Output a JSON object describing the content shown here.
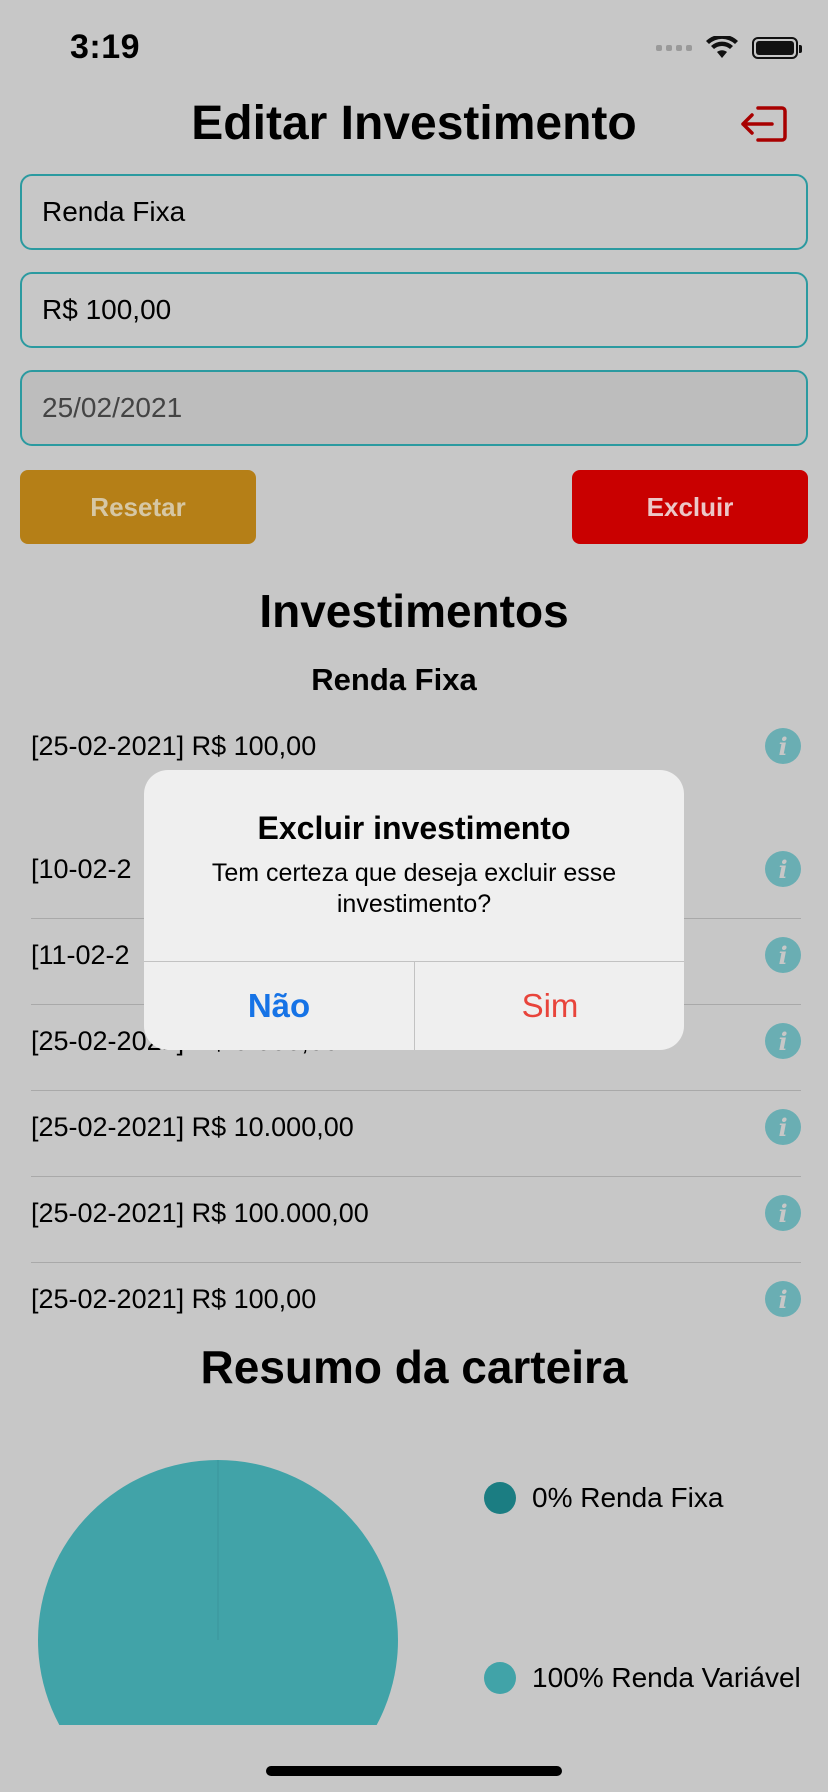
{
  "status_bar": {
    "time": "3:19"
  },
  "header": {
    "title": "Editar Investimento"
  },
  "form": {
    "type_value": "Renda Fixa",
    "amount_value": "R$ 100,00",
    "date_value": "25/02/2021",
    "reset_label": "Resetar",
    "delete_label": "Excluir"
  },
  "investments": {
    "title": "Investimentos",
    "group_title": "Renda Fixa",
    "items": [
      "[25-02-2021] R$ 100,00",
      "[10-02-2",
      "[11-02-2",
      "[25-02-2021] R$ 5.000,00",
      "[25-02-2021] R$ 10.000,00",
      "[25-02-2021] R$ 100.000,00",
      "[25-02-2021] R$ 100,00"
    ]
  },
  "summary": {
    "title": "Resumo da carteira",
    "legend": [
      {
        "label": "0% Renda Fixa",
        "color": "#1b7d82"
      },
      {
        "label": "100% Renda Variável",
        "color": "#41a3a8"
      }
    ]
  },
  "chart_data": {
    "type": "pie",
    "categories": [
      "Renda Fixa",
      "Renda Variável"
    ],
    "values": [
      0,
      100
    ]
  },
  "dialog": {
    "title": "Excluir investimento",
    "message": "Tem certeza que deseja excluir esse investimento?",
    "no_label": "Não",
    "yes_label": "Sim"
  },
  "colors": {
    "accent": "#2b9aa0",
    "reset": "#b57f17",
    "delete": "#c90000",
    "alert_no": "#1673e6",
    "alert_yes": "#e8443b"
  }
}
